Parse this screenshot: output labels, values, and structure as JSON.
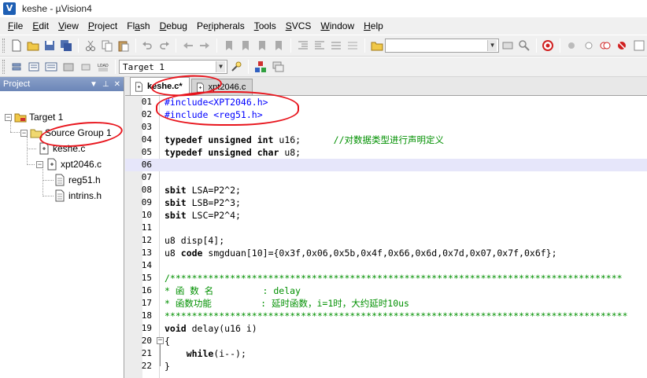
{
  "window": {
    "title": "keshe  - µVision4",
    "app_icon": "uvision-icon"
  },
  "menu": [
    {
      "pre": "",
      "ul": "F",
      "post": "ile"
    },
    {
      "pre": "",
      "ul": "E",
      "post": "dit"
    },
    {
      "pre": "",
      "ul": "V",
      "post": "iew"
    },
    {
      "pre": "",
      "ul": "P",
      "post": "roject"
    },
    {
      "pre": "Fl",
      "ul": "a",
      "post": "sh"
    },
    {
      "pre": "",
      "ul": "D",
      "post": "ebug"
    },
    {
      "pre": "Pe",
      "ul": "r",
      "post": "ipherals"
    },
    {
      "pre": "",
      "ul": "T",
      "post": "ools"
    },
    {
      "pre": "",
      "ul": "S",
      "post": "VCS"
    },
    {
      "pre": "",
      "ul": "W",
      "post": "indow"
    },
    {
      "pre": "",
      "ul": "H",
      "post": "elp"
    }
  ],
  "toolbar2": {
    "target_value": "Target 1"
  },
  "project": {
    "header": "Project",
    "tree": {
      "root": "Target 1",
      "group": "Source Group 1",
      "files": [
        "keshe.c",
        "xpt2046.c"
      ],
      "includes": [
        "reg51.h",
        "intrins.h"
      ]
    }
  },
  "tabs": [
    {
      "label": "keshe.c*",
      "active": true
    },
    {
      "label": "xpt2046.c",
      "active": false
    }
  ],
  "code_lines": [
    {
      "n": "01",
      "html": "<span class=\"pp\">#include&lt;XPT2046.h&gt;</span>"
    },
    {
      "n": "02",
      "html": "<span class=\"pp\">#include &lt;reg51.h&gt;</span>"
    },
    {
      "n": "03",
      "html": ""
    },
    {
      "n": "04",
      "html": "<span class=\"kw\">typedef unsigned int</span> u16;      <span class=\"cmt\">//对数据类型进行声明定义</span>"
    },
    {
      "n": "05",
      "html": "<span class=\"kw\">typedef unsigned char</span> u8;"
    },
    {
      "n": "06",
      "html": "",
      "current": true
    },
    {
      "n": "07",
      "html": ""
    },
    {
      "n": "08",
      "html": "<span class=\"kw\">sbit</span> LSA=P2^2;"
    },
    {
      "n": "09",
      "html": "<span class=\"kw\">sbit</span> LSB=P2^3;"
    },
    {
      "n": "10",
      "html": "<span class=\"kw\">sbit</span> LSC=P2^4;"
    },
    {
      "n": "11",
      "html": ""
    },
    {
      "n": "12",
      "html": "u8 disp[4];"
    },
    {
      "n": "13",
      "html": "u8 <span class=\"kw\">code</span> smgduan[10]={0x3f,0x06,0x5b,0x4f,0x66,0x6d,0x7d,0x07,0x7f,0x6f};"
    },
    {
      "n": "14",
      "html": ""
    },
    {
      "n": "15",
      "html": "<span class=\"cmt\">/***********************************************************************************</span>"
    },
    {
      "n": "16",
      "html": "<span class=\"cmt\">* 函 数 名         : delay</span>"
    },
    {
      "n": "17",
      "html": "<span class=\"cmt\">* 函数功能         : 延时函数，i=1时，大约延时10us</span>"
    },
    {
      "n": "18",
      "html": "<span class=\"cmt\">*************************************************************************************</span>"
    },
    {
      "n": "19",
      "html": "<span class=\"kw\">void</span> delay(u16 i)"
    },
    {
      "n": "20",
      "html": "{",
      "fold": true
    },
    {
      "n": "21",
      "html": "    <span class=\"kw\">while</span>(i--);"
    },
    {
      "n": "22",
      "html": "}"
    }
  ],
  "colors": {
    "annotation": "#e8141c",
    "comment": "#009000",
    "preprocessor": "#0000ff"
  }
}
